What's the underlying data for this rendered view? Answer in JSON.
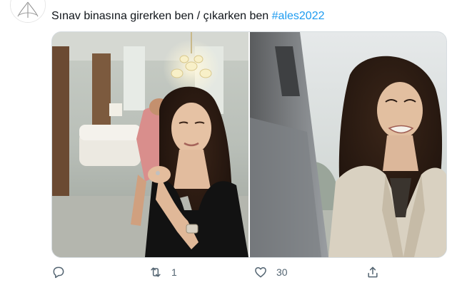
{
  "tweet": {
    "text_plain": "Sınav binasına girerken ben / çıkarken ben ",
    "hashtag": "#ales2022"
  },
  "media": {
    "left_image": "woman-smiling-in-luxury-room",
    "right_image": "woman-crying-outdoors"
  },
  "actions": {
    "reply_icon": "reply-icon",
    "retweet_icon": "retweet-icon",
    "retweet_count": "1",
    "like_icon": "heart-icon",
    "like_count": "30",
    "share_icon": "share-icon"
  },
  "colors": {
    "text": "#0f1419",
    "hashtag": "#1d9bf0",
    "icon": "#536471"
  }
}
